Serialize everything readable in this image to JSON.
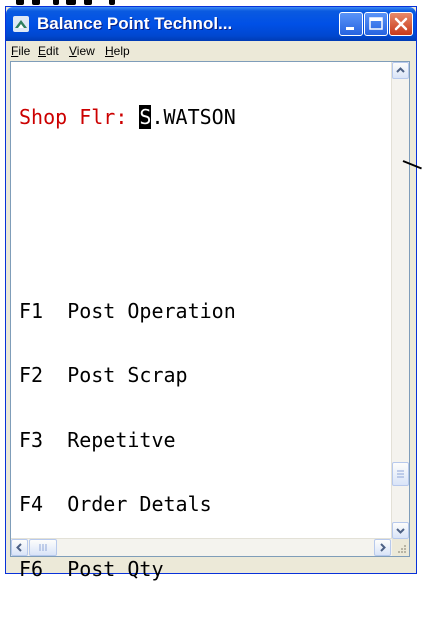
{
  "window": {
    "title": "Balance Point Technol...",
    "colors": {
      "titlebar": "#0050e6",
      "close_button": "#c8391a"
    }
  },
  "menubar": {
    "items": [
      {
        "label": "File",
        "mnemonic": "F",
        "rest": "ile"
      },
      {
        "label": "Edit",
        "mnemonic": "E",
        "rest": "dit"
      },
      {
        "label": "View",
        "mnemonic": "V",
        "rest": "iew"
      },
      {
        "label": "Help",
        "mnemonic": "H",
        "rest": "elp"
      }
    ]
  },
  "terminal": {
    "prompt_label": "Shop Flr:",
    "user_cursor_char": "S",
    "user_rest": ".WATSON",
    "menu_options": [
      {
        "key": "F1",
        "label": "Post Operation"
      },
      {
        "key": "F2",
        "label": "Post Scrap"
      },
      {
        "key": "F3",
        "label": "Repetitve"
      },
      {
        "key": "F4",
        "label": "Order Detals"
      },
      {
        "key": "F6",
        "label": "Post Qty"
      }
    ],
    "colors": {
      "prompt": "#cc0000",
      "text": "#000000"
    }
  },
  "icons": {
    "app": "terminal-app-icon",
    "minimize": "minimize-icon",
    "maximize": "maximize-icon",
    "close": "close-icon",
    "scroll_up": "chevron-up-icon",
    "scroll_down": "chevron-down-icon",
    "scroll_left": "chevron-left-icon",
    "scroll_right": "chevron-right-icon"
  }
}
